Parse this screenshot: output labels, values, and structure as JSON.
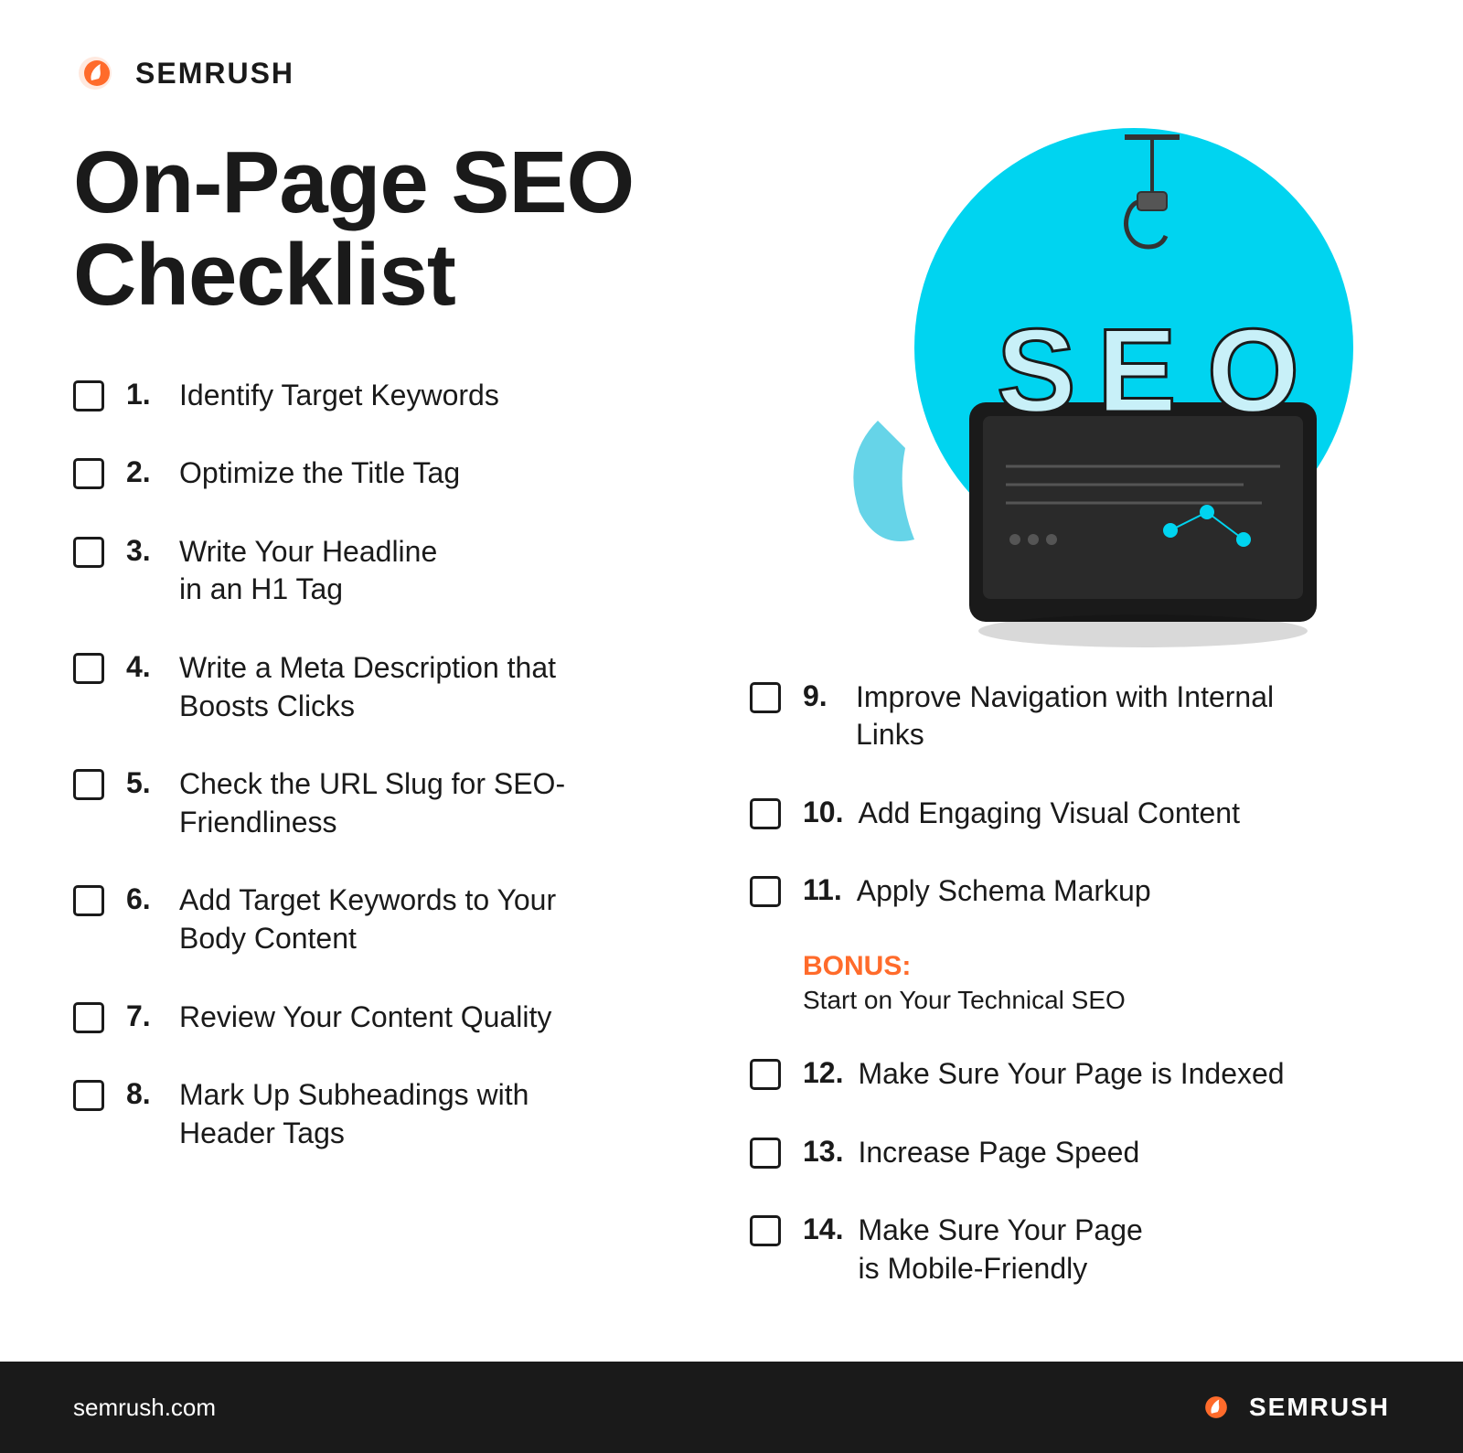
{
  "header": {
    "logo_text": "SEMRUSH"
  },
  "title": {
    "line1": "On-Page SEO",
    "line2": "Checklist"
  },
  "left_items": [
    {
      "number": "1.",
      "text": "Identify Target Keywords"
    },
    {
      "number": "2.",
      "text": "Optimize the Title Tag"
    },
    {
      "number": "3.",
      "text": "Write Your Headline\nin an H1 Tag"
    },
    {
      "number": "4.",
      "text": "Write a Meta Description that\nBoosts Clicks"
    },
    {
      "number": "5.",
      "text": "Check the URL Slug for SEO-\nFriendliness"
    },
    {
      "number": "6.",
      "text": "Add Target Keywords to Your\nBody Content"
    },
    {
      "number": "7.",
      "text": "Review Your Content Quality"
    },
    {
      "number": "8.",
      "text": "Mark Up Subheadings with\nHeader Tags"
    }
  ],
  "right_items": [
    {
      "number": "9.",
      "text": "Improve Navigation with Internal\nLinks"
    },
    {
      "number": "10.",
      "text": "Add Engaging Visual Content"
    },
    {
      "number": "11.",
      "text": "Apply Schema Markup"
    },
    {
      "number": "12.",
      "text": "Make Sure Your Page is Indexed"
    },
    {
      "number": "13.",
      "text": "Increase Page Speed"
    },
    {
      "number": "14.",
      "text": "Make Sure Your Page\nis Mobile-Friendly"
    }
  ],
  "bonus": {
    "label": "BONUS:",
    "subtitle": "Start on Your Technical SEO"
  },
  "footer": {
    "url": "semrush.com",
    "logo_text": "SEMRUSH"
  },
  "colors": {
    "orange": "#ff6b2b",
    "dark": "#1a1a1a",
    "cyan": "#00d4f0",
    "white": "#ffffff"
  }
}
